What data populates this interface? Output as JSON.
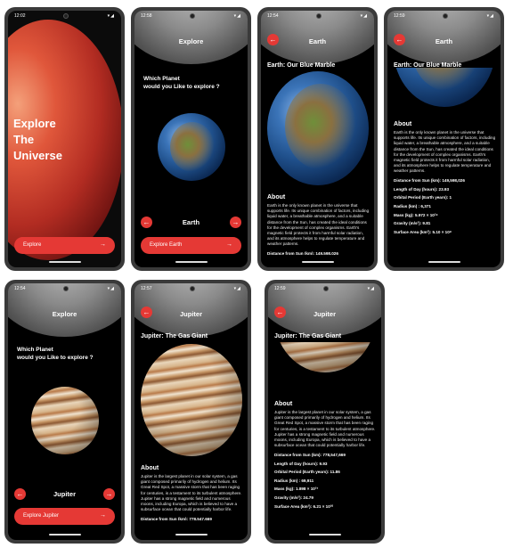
{
  "status": {
    "s1_time": "12:02",
    "s2_time": "12:58",
    "s3_time": "12:54",
    "s4_time": "12:59",
    "s5_time": "12:54",
    "s6_time": "12:57",
    "s7_time": "12:59",
    "icons": "▾◢"
  },
  "icons": {
    "back": "arrow-back-icon",
    "prev": "chevron-left-icon",
    "next": "chevron-right-icon",
    "go": "arrow-right-icon"
  },
  "colors": {
    "accent": "#e53935",
    "background": "#000000"
  },
  "splash": {
    "line1": "Explore",
    "line2": "The",
    "line3": "Universe",
    "button": "Explore"
  },
  "explore_earth": {
    "title": "Explore",
    "question1": "Which Planet",
    "question2": "would you Like to explore ?",
    "planet": "Earth",
    "button": "Explore Earth"
  },
  "earth_detail": {
    "title": "Earth",
    "subtitle": "Earth: Our Blue Marble",
    "about_heading": "About",
    "about_text": "Earth is the only known planet in the universe that supports life. Its unique combination of factors, including liquid water, a breathable atmosphere, and a suitable distance from the Sun, has created the ideal conditions for the development of complex organisms. Earth's magnetic field protects it from harmful solar radiation, and its atmosphere helps to regulate temperature and weather patterns.",
    "cut_line": "Distance from Sun (km): 149,598,026",
    "stats": [
      "Distance from Sun (km): 149,598,026",
      "Length of Day (hours): 23.93",
      "Orbital Period (Earth years): 1",
      "Radius (km) : 6,371",
      "Mass (kg): 5.972 × 10²⁴",
      "Gravity (m/s²): 9.81",
      "Surface Area (km²): 5.10 × 10⁸"
    ]
  },
  "explore_jupiter": {
    "title": "Explore",
    "question1": "Which Planet",
    "question2": "would you Like to explore ?",
    "planet": "Jupiter",
    "button": "Explore Jupiter"
  },
  "jupiter_detail": {
    "title": "Jupiter",
    "subtitle": "Jupiter: The Gas Giant",
    "about_heading": "About",
    "about_text": "Jupiter is the largest planet in our solar system, a gas giant composed primarily of hydrogen and helium. Its Great Red Spot, a massive storm that has been raging for centuries, is a testament to its turbulent atmosphere. Jupiter has a strong magnetic field and numerous moons, including Europa, which is believed to have a subsurface ocean that could potentially harbor life.",
    "cut_line": "Distance from Sun (km): 778,547,669",
    "stats": [
      "Distance from Sun (km): 778,547,669",
      "Length of Day (hours): 9.93",
      "Orbital Period (Earth years): 11.86",
      "Radius (km) : 69,911",
      "Mass (kg): 1.898 × 10²⁷",
      "Gravity (m/s²): 24.79",
      "Surface Area (km²): 6.21 × 10¹⁰"
    ]
  }
}
